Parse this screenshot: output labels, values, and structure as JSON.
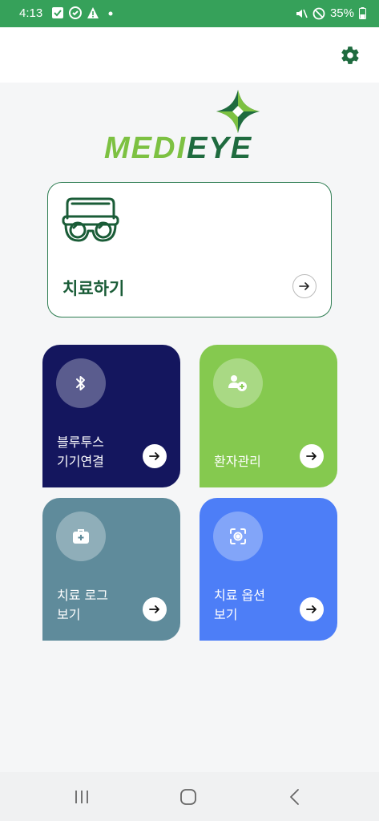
{
  "status_bar": {
    "time": "4:13",
    "battery": "35%",
    "color": "#36a15a"
  },
  "app_bar": {
    "settings_icon": "gear-icon"
  },
  "logo": {
    "text_left": "MEDI",
    "text_right": "EYE",
    "colors": {
      "light": "#7dc142",
      "dark": "#1f6b3f"
    }
  },
  "treatment_card": {
    "label": "치료하기",
    "icon": "goggles-icon"
  },
  "tiles": [
    {
      "label": "블루투스\n기기연결",
      "icon": "bluetooth-icon",
      "color": "#14165e"
    },
    {
      "label": "환자관리",
      "icon": "add-user-icon",
      "color": "#85c94f"
    },
    {
      "label": "치료 로그\n보기",
      "icon": "medical-kit-icon",
      "color": "#5f8b9b"
    },
    {
      "label": "치료 옵션\n보기",
      "icon": "focus-camera-icon",
      "color": "#4d7ef7"
    }
  ],
  "nav_bar": {
    "buttons": [
      "recent-apps-icon",
      "home-icon",
      "back-icon"
    ]
  }
}
